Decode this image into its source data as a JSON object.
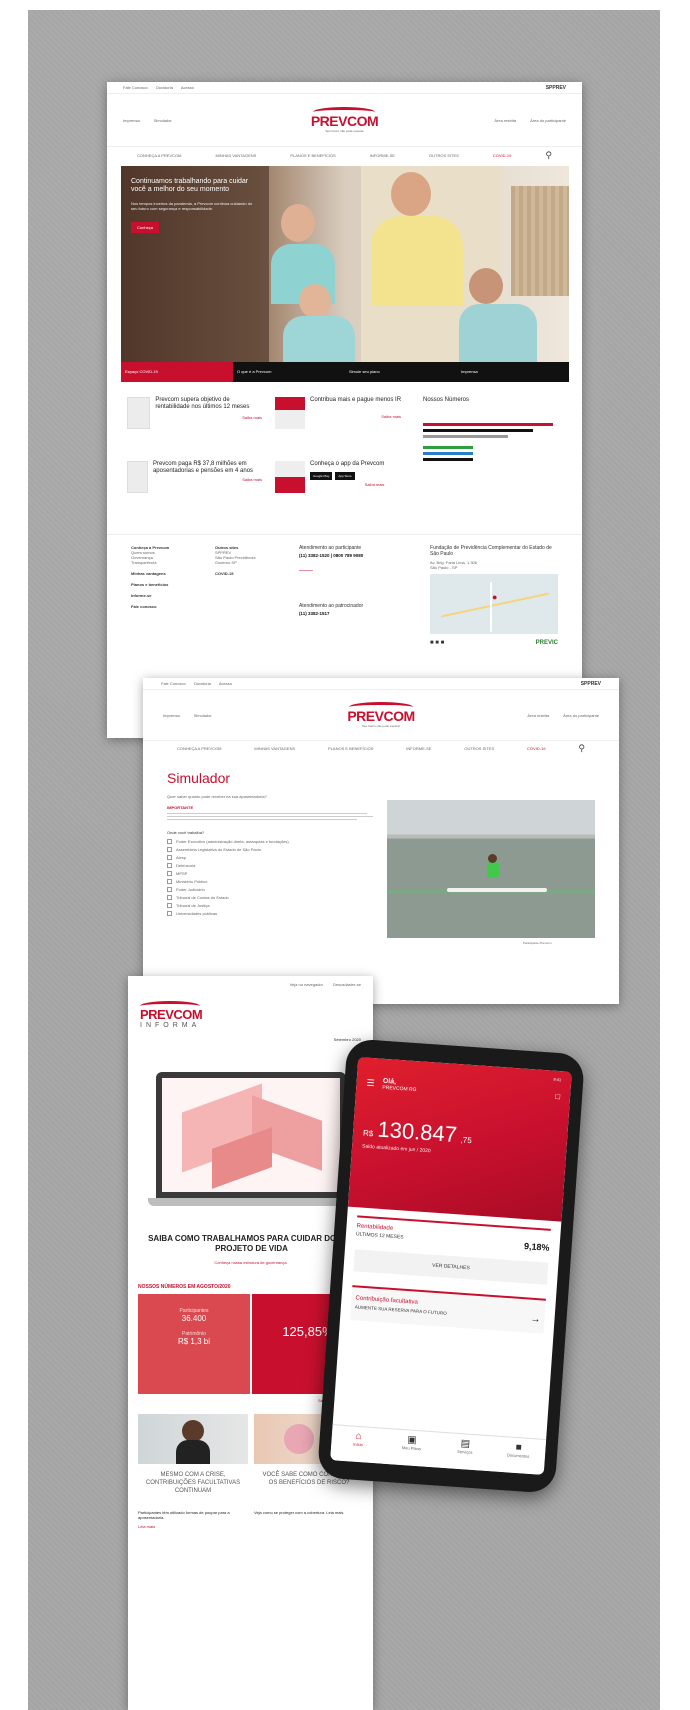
{
  "home": {
    "topbar_links": [
      "Fale Conosco",
      "Ouvidoria",
      "Acesso"
    ],
    "topbar_right": "SPPREV",
    "header_left": [
      "Imprensa",
      "Simulador"
    ],
    "header_right": [
      "Área restrita",
      "Área do participante"
    ],
    "logo_text": "PREVCOM",
    "logo_tag": "Seu futuro não pode esperar",
    "nav": [
      "CONHEÇA A PREVCOM",
      "MINHAS VANTAGENS",
      "PLANOS E BENEFÍCIOS",
      "INFORME-SE",
      "OUTROS SITES",
      "COVID-19"
    ],
    "hero_title": "Continuamos trabalhando para cuidar você a melhor do seu momento",
    "hero_body": "Nos tempos incertos da pandemia, a Prevcom continua cuidando do seu futuro com segurança e responsabilidade.",
    "hero_button": "Conheça",
    "tabs": [
      "Espaço COVID-19",
      "O que é a Prevcom",
      "Simule seu plano",
      "Imprensa"
    ],
    "news": [
      {
        "title": "Prevcom supera objetivo de rentabilidade nos últimos 12 meses",
        "link": "Saiba mais"
      },
      {
        "title": "Contribua mais e pague menos IR",
        "link": "Saiba mais"
      },
      {
        "title": "Prevcom paga R$ 37,8 milhões em aposentadorias e pensões em 4 anos",
        "link": "Saiba mais"
      },
      {
        "title": "Conheça o app da Prevcom",
        "link": "Saiba mais"
      }
    ],
    "numbers_title": "Nossos Números",
    "store_badges": [
      "Google Play",
      "App Store"
    ],
    "footer_cols": [
      [
        "Conheça a Prevcom",
        "Quem somos",
        "Governança",
        "Transparência",
        "Minhas vantagens",
        "Planos e benefícios",
        "Informe-se",
        "Fale conosco"
      ],
      [
        "Outros sites",
        "SPPREV",
        "São Paulo Previdência",
        "Governo SP",
        "COVID-19"
      ],
      [
        "Atendimento ao participante",
        "(11) 3382-1520 | 0800 789 9080",
        "Atendimento ao patrocinador",
        "(11) 3382-1517"
      ],
      [
        "Fundação de Previdência Complementar do Estado de São Paulo",
        "Av. Brig. Faria Lima, 1.306",
        "São Paulo - SP"
      ]
    ],
    "previc": "PREVIC"
  },
  "simulator": {
    "title": "Simulador",
    "intro": "Quer saber quanto pode receber na sua aposentadoria?",
    "important_label": "IMPORTANTE",
    "question": "Onde você trabalha?",
    "options": [
      "Poder Executivo (administração direta, autarquias e fundações)",
      "Assembleia Legislativa do Estado de São Paulo",
      "Alesp",
      "Defensoria",
      "MPSP",
      "Ministério Público",
      "Poder Judiciário",
      "Tribunal de Contas do Estado",
      "Tribunal de Justiça",
      "Universidades públicas"
    ],
    "caption": "Participante Prevcom"
  },
  "newsletter": {
    "top_links": [
      "Veja no navegador",
      "Descadastre-se"
    ],
    "brand": "PREVCOM",
    "subtitle": "INFORMA",
    "date": "Setembro 2020",
    "headline": "SAIBA COMO TRABALHAMOS PARA CUIDAR DO SEU PROJETO DE VIDA",
    "headline_link": "Conheça nossa estrutura de governança",
    "numbers_title": "NOSSOS NÚMEROS EM AGOSTO/2020",
    "stats": [
      "Participantes",
      "36.400",
      "Patrimônio",
      "R$ 1,3 bi",
      "125,85%"
    ],
    "more_link": "Saiba mais",
    "articles": [
      {
        "title": "MESMO COM A CRISE, CONTRIBUIÇÕES FACULTATIVAS CONTINUAM",
        "text": "Participantes têm utilizado formas de poupar para a aposentadoria.",
        "link": "Leia mais"
      },
      {
        "title": "VOCÊ SABE COMO CONTRATAR OS BENEFÍCIOS DE RISCO?",
        "text": "Veja como se proteger com a cobertura. Leia mais"
      }
    ]
  },
  "app": {
    "status": "9:41",
    "greeting": "Olá,",
    "plan": "PREVCOM RG",
    "balance_prefix": "R$",
    "balance": "130.847",
    "balance_cents": ",75",
    "balance_note": "Saldo atualizado em jun / 2020",
    "card1_title": "Rentabilidade",
    "card1_sub": "ÚLTIMOS 12 MESES",
    "card1_value": "9,18%",
    "card1_button": "VER DETALHES",
    "card2_title": "Contribuição facultativa",
    "card2_sub": "AUMENTE SUA RESERVA PARA O FUTURO",
    "tabs": [
      "Início",
      "Meu Plano",
      "Serviços",
      "Documentos"
    ]
  }
}
